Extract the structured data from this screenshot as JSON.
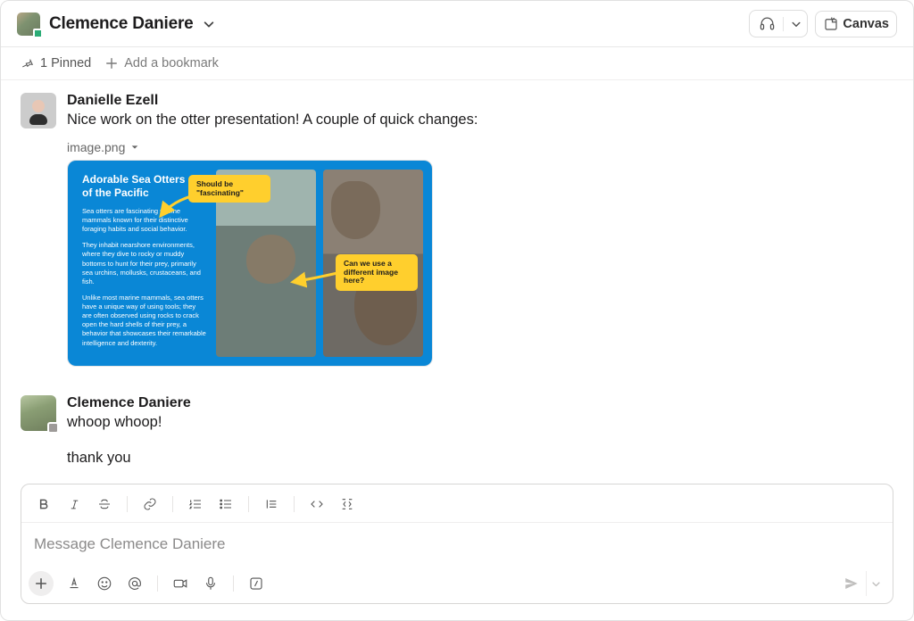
{
  "header": {
    "dm_name": "Clemence Daniere",
    "canvas_label": "Canvas"
  },
  "bookmarkbar": {
    "pinned_label": "1 Pinned",
    "add_bookmark_label": "Add a bookmark"
  },
  "messages": [
    {
      "author": "Danielle Ezell",
      "text": "Nice work on the otter presentation! A couple of quick changes:",
      "attachment": {
        "filename": "image.png",
        "slide": {
          "title_line1": "Adorable Sea Otters",
          "title_line2": "of the Pacific",
          "para1": "Sea otters are fascinating marine mammals known for their distinctive foraging habits and social behavior.",
          "para2": "They inhabit nearshore environments, where they dive to rocky or muddy bottoms to hunt for their prey, primarily sea urchins, mollusks, crustaceans, and fish.",
          "para3": "Unlike most marine mammals, sea otters have a unique way of using tools; they are often observed using rocks to crack open the hard shells of their prey, a behavior that showcases their remarkable intelligence and dexterity.",
          "annotation1": "Should be \"fascinating\"",
          "annotation2": "Can we use a different image here?"
        }
      }
    },
    {
      "author": "Clemence Daniere",
      "text": "whoop whoop!",
      "text_secondary": "thank you"
    }
  ],
  "composer": {
    "placeholder": "Message Clemence Daniere"
  }
}
